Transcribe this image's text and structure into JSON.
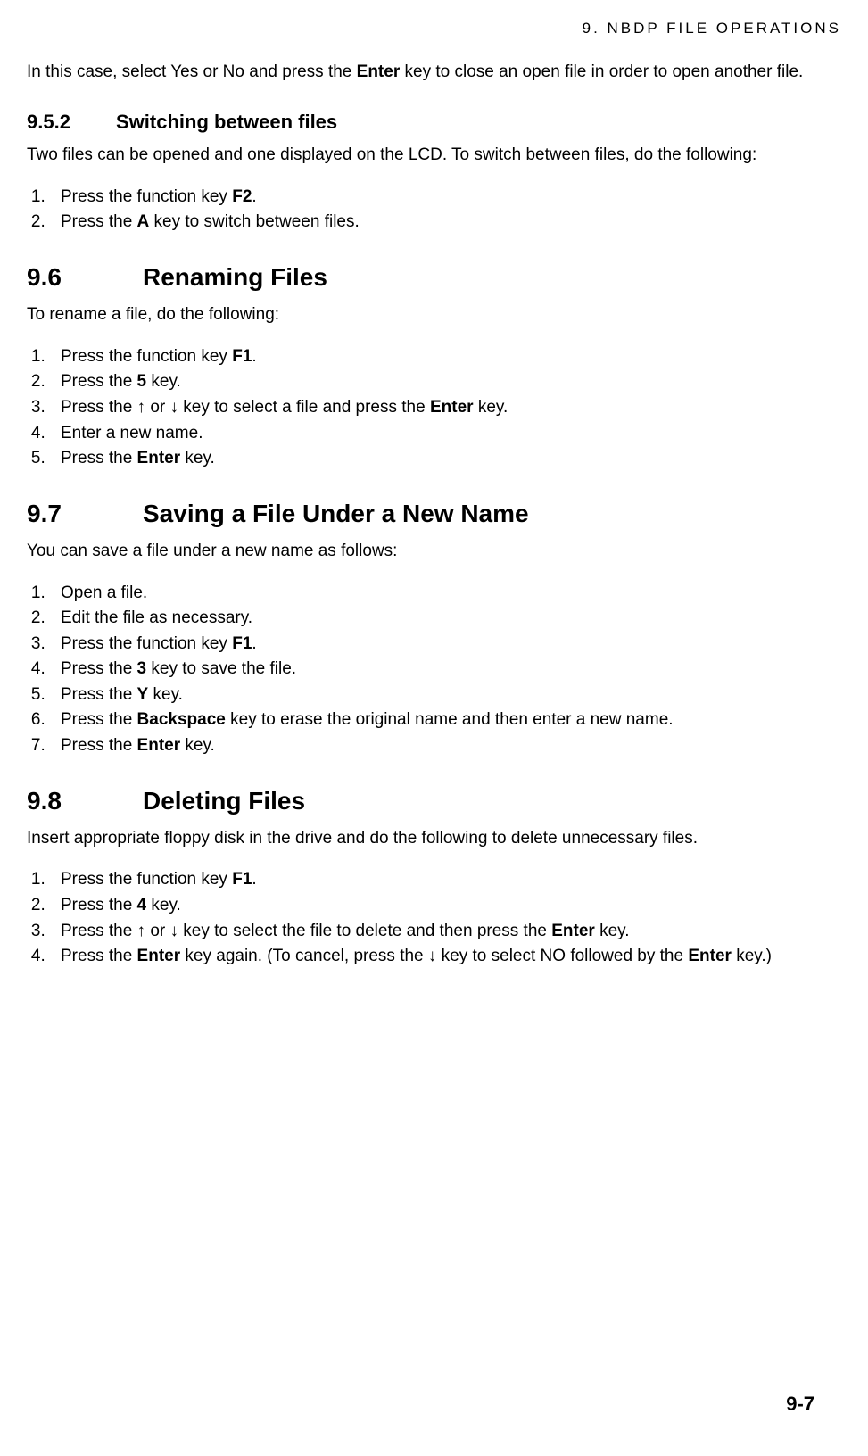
{
  "header": {
    "running_title": "9.  NBDP  FILE  OPERATIONS"
  },
  "intro": {
    "prefix": "In this case, select Yes or No and press the ",
    "bold1": "Enter",
    "suffix": " key to close an open file in order to open another file."
  },
  "sec952": {
    "num": "9.5.2",
    "title": "Switching between files",
    "intro": "Two files can be opened and one displayed on the LCD. To switch between files, do the following:",
    "s1_a": "Press the function key ",
    "s1_b": "F2",
    "s1_c": ".",
    "s2_a": "Press the ",
    "s2_b": "A",
    "s2_c": " key to switch between files."
  },
  "sec96": {
    "num": "9.6",
    "title": "Renaming Files",
    "intro": "To rename a file, do the following:",
    "s1_a": "Press the function key ",
    "s1_b": "F1",
    "s1_c": ".",
    "s2_a": "Press the ",
    "s2_b": "5",
    "s2_c": " key.",
    "s3_a": "Press the ↑ or ↓ key to select a file and press the ",
    "s3_b": "Enter",
    "s3_c": " key.",
    "s4": "Enter a new name.",
    "s5_a": "Press the ",
    "s5_b": "Enter",
    "s5_c": " key."
  },
  "sec97": {
    "num": "9.7",
    "title": "Saving a File Under a New Name",
    "intro": "You can save a file under a new name as follows:",
    "s1": "Open a file.",
    "s2": "Edit the file as necessary.",
    "s3_a": "Press the function key ",
    "s3_b": "F1",
    "s3_c": ".",
    "s4_a": "Press the ",
    "s4_b": "3",
    "s4_c": " key to save the file.",
    "s5_a": "Press the ",
    "s5_b": "Y",
    "s5_c": " key.",
    "s6_a": "Press the ",
    "s6_b": "Backspace",
    "s6_c": " key to erase the original name and then enter a new name.",
    "s7_a": "Press the ",
    "s7_b": "Enter",
    "s7_c": " key."
  },
  "sec98": {
    "num": "9.8",
    "title": "Deleting Files",
    "intro": "Insert appropriate floppy disk in the drive and do the following to delete unnecessary files.",
    "s1_a": "Press the function key ",
    "s1_b": "F1",
    "s1_c": ".",
    "s2_a": "Press the ",
    "s2_b": "4",
    "s2_c": " key.",
    "s3_a": "Press the ↑ or ↓ key to select the file to delete and then press the ",
    "s3_b": "Enter",
    "s3_c": " key.",
    "s4_a": "Press the ",
    "s4_b": "Enter",
    "s4_c": " key again. (To cancel, press the ↓ key to select NO followed by the ",
    "s4_d": "Enter",
    "s4_e": " key.)"
  },
  "footer": {
    "page_number": "9-7"
  }
}
